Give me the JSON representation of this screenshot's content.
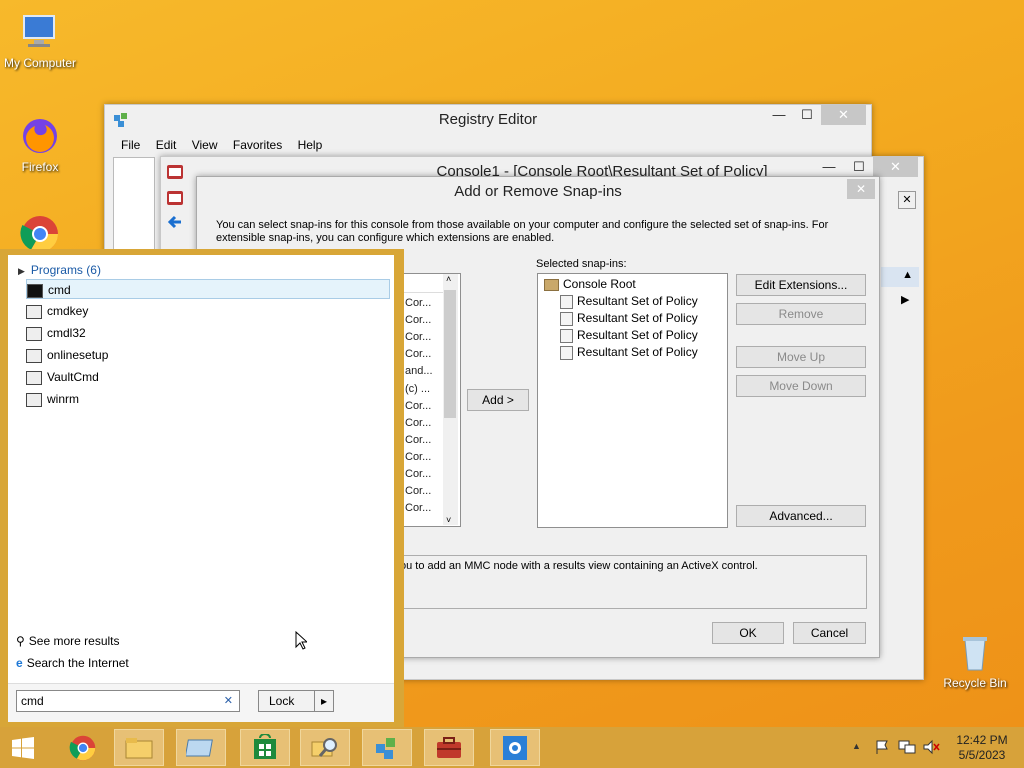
{
  "desktop": {
    "icons": [
      {
        "label": "My Computer"
      },
      {
        "label": "Firefox"
      },
      {
        "label": "Recycle Bin"
      }
    ]
  },
  "registry_editor": {
    "title": "Registry Editor",
    "menu": [
      "File",
      "Edit",
      "View",
      "Favorites",
      "Help"
    ],
    "min": "—",
    "max": "☐",
    "close": "✕"
  },
  "console": {
    "title": "Console1 - [Console Root\\Resultant Set of Policy]",
    "min": "—",
    "max": "☐",
    "close": "✕",
    "inner_close": "✕"
  },
  "snapins": {
    "title": "Add or Remove Snap-ins",
    "close": "✕",
    "description": "You can select snap-ins for this console from those available on your computer and configure the selected set of snap-ins. For extensible snap-ins, you can configure which extensions are enabled.",
    "available_rows": [
      "Cor...",
      "Cor...",
      "Cor...",
      "Cor...",
      "and...",
      "(c) ...",
      "Cor...",
      "Cor...",
      "Cor...",
      "Cor...",
      "Cor...",
      "Cor...",
      "Cor..."
    ],
    "add_button": "Add >",
    "selected_label": "Selected snap-ins:",
    "selected_tree": {
      "root": "Console Root",
      "children": [
        "Resultant Set of Policy",
        "Resultant Set of Policy",
        "Resultant Set of Policy",
        "Resultant Set of Policy"
      ]
    },
    "buttons": {
      "edit_extensions": "Edit Extensions...",
      "remove": "Remove",
      "move_up": "Move Up",
      "move_down": "Move Down",
      "advanced": "Advanced...",
      "ok": "OK",
      "cancel": "Cancel"
    },
    "desc_box": "ou to add an MMC node with a results view containing an ActiveX control."
  },
  "search_panel": {
    "group_label": "Programs (6)",
    "results": [
      "cmd",
      "cmdkey",
      "cmdl32",
      "onlinesetup",
      "VaultCmd",
      "winrm"
    ],
    "see_more": "See more results",
    "search_internet": "Search the Internet",
    "search_value": "cmd",
    "clear": "✕",
    "lock_label": "Lock",
    "lock_arrow": "▸"
  },
  "taskbar": {
    "clock_time": "12:42 PM",
    "clock_date": "5/5/2023",
    "tray_arrow": "▲"
  },
  "colors": {
    "accent": "#d7a23a",
    "selection": "#e5f3fb",
    "dialog_bg": "#f0f0f0"
  }
}
